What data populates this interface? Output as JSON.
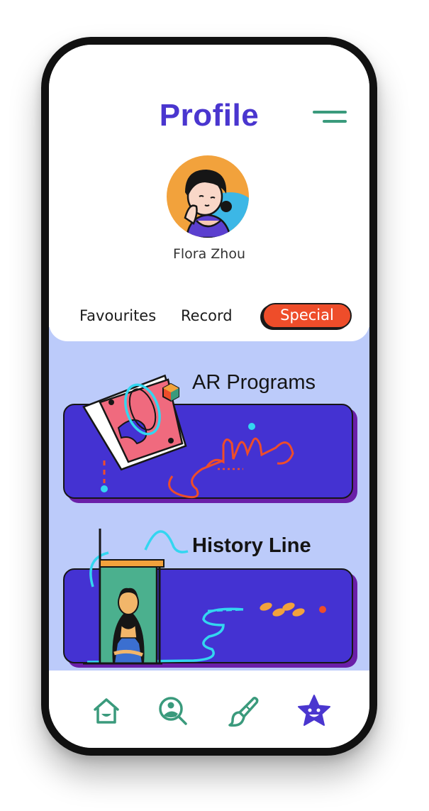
{
  "header": {
    "title": "Profile"
  },
  "menu": {
    "icon": "menu-icon"
  },
  "user": {
    "name": "Flora Zhou",
    "avatar_icon": "avatar-illustration"
  },
  "tabs": [
    {
      "label": "Favourites",
      "active": false
    },
    {
      "label": "Record",
      "active": false
    },
    {
      "label": "Special",
      "active": true
    }
  ],
  "cards": [
    {
      "title": "AR Programs",
      "icon": "ar-illustration"
    },
    {
      "title": "History Line",
      "icon": "history-illustration"
    }
  ],
  "bottom_nav": [
    {
      "icon": "home-icon",
      "active": false
    },
    {
      "icon": "explore-icon",
      "active": false
    },
    {
      "icon": "brush-icon",
      "active": false
    },
    {
      "icon": "star-icon",
      "active": true
    }
  ],
  "colors": {
    "accent": "#4a36cf",
    "nav_inactive": "#3a9a7c",
    "special_tab": "#ee4d2a",
    "content_bg": "#bccbfa",
    "card_bg": "#4432d2"
  }
}
